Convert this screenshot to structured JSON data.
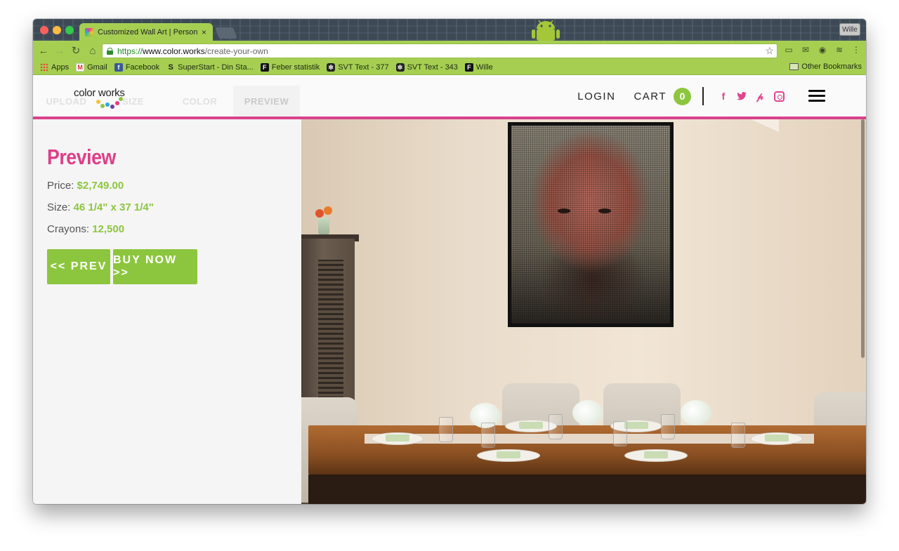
{
  "browser": {
    "tab_title": "Customized Wall Art | Persona",
    "tab_close": "×",
    "profile_label": "Wille",
    "url": {
      "scheme": "https://",
      "host": "www.color.works",
      "path": "/create-your-own"
    },
    "bookmarks": [
      {
        "label": "Apps",
        "icon": "apps-icon"
      },
      {
        "label": "Gmail",
        "icon": "gmail-icon"
      },
      {
        "label": "Facebook",
        "icon": "facebook-icon"
      },
      {
        "label": "SuperStart - Din Sta...",
        "icon": "superstart-icon"
      },
      {
        "label": "Feber statistik",
        "icon": "feber-icon"
      },
      {
        "label": "SVT Text - 377",
        "icon": "svt-icon"
      },
      {
        "label": "SVT Text - 343",
        "icon": "svt-icon"
      },
      {
        "label": "Wille",
        "icon": "feber-icon"
      }
    ],
    "other_bookmarks": "Other Bookmarks"
  },
  "site": {
    "logo": "color works",
    "steps": [
      "UPLOAD",
      "SIZE",
      "COLOR",
      "PREVIEW"
    ],
    "nav": {
      "login": "LOGIN",
      "cart": "CART",
      "cart_count": "0"
    },
    "social": [
      "facebook-icon",
      "twitter-icon",
      "pinterest-icon",
      "instagram-icon"
    ],
    "accent_pink": "#d9428c",
    "accent_green": "#8cc63e"
  },
  "preview": {
    "title": "Preview",
    "price_label": "Price:",
    "price_value": "$2,749.00",
    "size_label": "Size:",
    "size_value": "46 1/4\" x 37 1/4\"",
    "crayons_label": "Crayons:",
    "crayons_value": "12,500",
    "prev_button": "<< PREV",
    "buy_button": "BUY NOW >>"
  }
}
